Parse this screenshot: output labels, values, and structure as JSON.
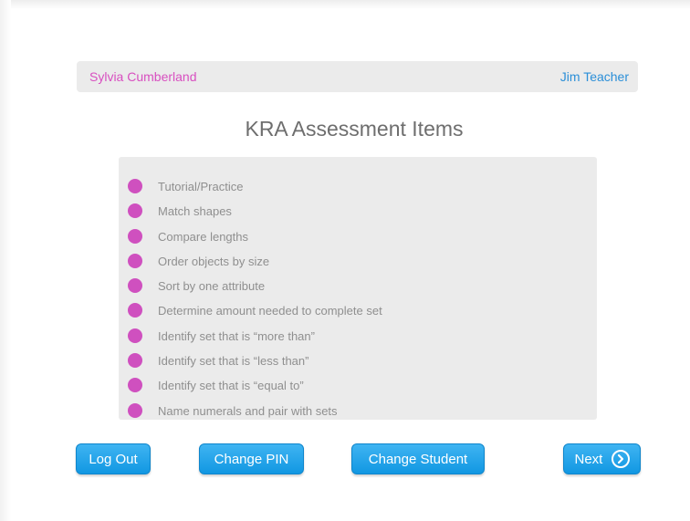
{
  "header": {
    "student_name": "Sylvia Cumberland",
    "teacher_name": "Jim Teacher"
  },
  "page_title": "KRA Assessment Items",
  "items": [
    "Tutorial/Practice",
    "Match shapes",
    "Compare lengths",
    "Order objects by size",
    "Sort by one attribute",
    "Determine amount needed to complete set",
    "Identify set that is “more than”",
    "Identify set that is “less than”",
    "Identify set that is “equal to”",
    "Name numerals and pair with sets"
  ],
  "buttons": {
    "log_out": "Log Out",
    "change_pin": "Change PIN",
    "change_student": "Change Student",
    "next": "Next"
  },
  "colors": {
    "accent_blue": "#1197e2",
    "student_pink": "#d84fc0",
    "bullet_pink": "#cf50bf",
    "panel_gray": "#ebebeb"
  },
  "icons": {
    "next": "chevron-right-circle-icon",
    "bullet": "bullet-dot-icon"
  }
}
